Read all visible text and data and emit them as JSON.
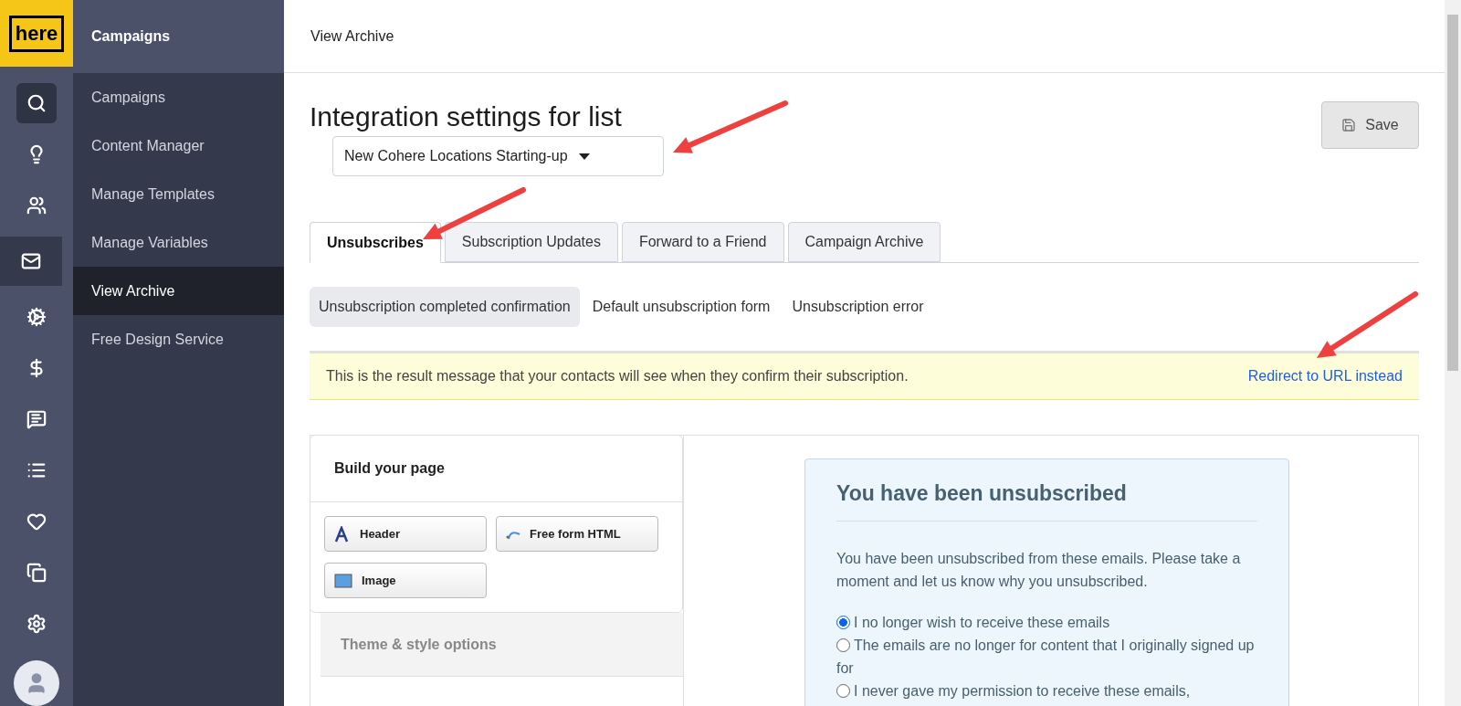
{
  "logo": {
    "text": "here"
  },
  "icon_rail": [
    {
      "kind": "search",
      "selected": false
    },
    {
      "kind": "bulb",
      "selected": false
    },
    {
      "kind": "contacts",
      "selected": false
    },
    {
      "kind": "mail",
      "selected": true
    },
    {
      "kind": "automation",
      "selected": false
    },
    {
      "kind": "dollar",
      "selected": false
    },
    {
      "kind": "chat",
      "selected": false
    },
    {
      "kind": "list",
      "selected": false
    },
    {
      "kind": "heart",
      "selected": false
    },
    {
      "kind": "copy",
      "selected": false
    },
    {
      "kind": "settings",
      "selected": false
    }
  ],
  "sidebar": {
    "title": "Campaigns",
    "items": [
      {
        "label": "Campaigns",
        "selected": false
      },
      {
        "label": "Content Manager",
        "selected": false
      },
      {
        "label": "Manage Templates",
        "selected": false
      },
      {
        "label": "Manage Variables",
        "selected": false
      },
      {
        "label": "View Archive",
        "selected": true
      },
      {
        "label": "Free Design Service",
        "selected": false
      }
    ]
  },
  "header": {
    "title": "View Archive"
  },
  "page": {
    "heading": "Integration settings for list",
    "list_select": {
      "value": "New Cohere Locations Starting-up"
    },
    "save_button": "Save"
  },
  "tabs": [
    {
      "label": "Unsubscribes",
      "selected": true
    },
    {
      "label": "Subscription Updates",
      "selected": false
    },
    {
      "label": "Forward to a Friend",
      "selected": false
    },
    {
      "label": "Campaign Archive",
      "selected": false
    }
  ],
  "subtabs": [
    {
      "label": "Unsubscription completed confirmation",
      "selected": true
    },
    {
      "label": "Default unsubscription form",
      "selected": false
    },
    {
      "label": "Unsubscription error",
      "selected": false
    }
  ],
  "banner": {
    "text": "This is the result message that your contacts will see when they confirm their subscription.",
    "link": "Redirect to URL instead"
  },
  "builder": {
    "title": "Build your page",
    "blocks": [
      {
        "kind": "header",
        "label": "Header"
      },
      {
        "kind": "html",
        "label": "Free form HTML"
      },
      {
        "kind": "image",
        "label": "Image"
      }
    ],
    "theme_section": "Theme & style options"
  },
  "preview": {
    "title": "You have been unsubscribed",
    "intro": "You have been unsubscribed from these emails. Please take a moment and let us know why you unsubscribed.",
    "options": [
      {
        "label": "I no longer wish to receive these emails",
        "selected": true
      },
      {
        "label": "The emails are no longer for content that I originally signed up for",
        "selected": false
      },
      {
        "label": "I never gave my permission to receive these emails,",
        "selected": false
      }
    ]
  }
}
